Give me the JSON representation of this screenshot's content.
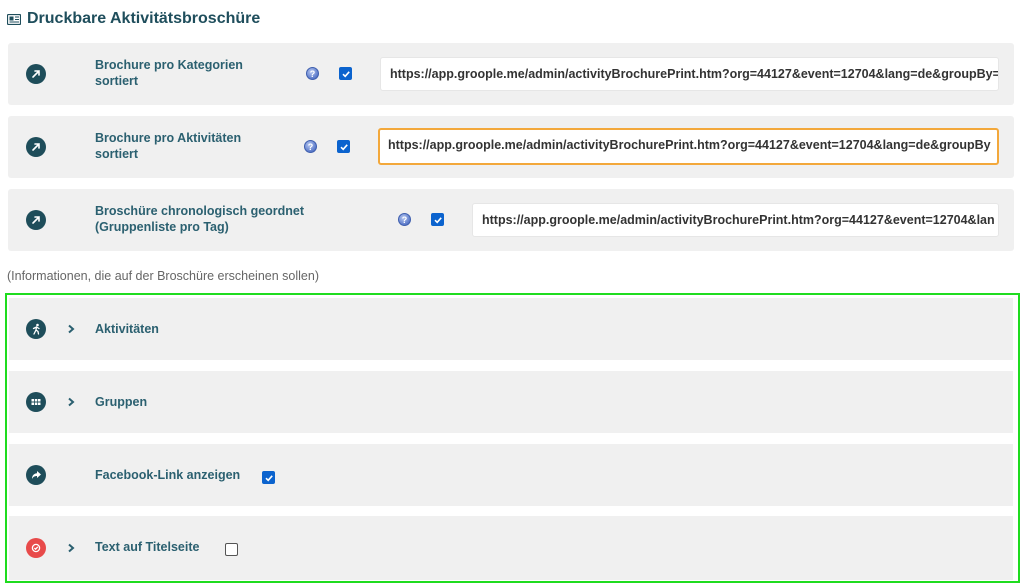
{
  "header": {
    "title": "Druckbare Aktivitätsbroschüre"
  },
  "brochures": [
    {
      "label_line1": "Brochure pro Kategorien",
      "label_line2": "sortiert",
      "url": "https://app.groople.me/admin/activityBrochurePrint.htm?org=44127&event=12704&lang=de&groupBy=",
      "checked": true
    },
    {
      "label_line1": "Brochure pro Aktivitäten",
      "label_line2": "sortiert",
      "url": "https://app.groople.me/admin/activityBrochurePrint.htm?org=44127&event=12704&lang=de&groupBy",
      "checked": true
    },
    {
      "label_line1": "Broschüre chronologisch geordnet",
      "label_line2": "(Gruppenliste pro Tag)",
      "url": "https://app.groople.me/admin/activityBrochurePrint.htm?org=44127&event=12704&lan",
      "checked": true
    }
  ],
  "help_glyph": "?",
  "note": "(Informationen, die auf der Broschüre erscheinen sollen)",
  "sections": [
    {
      "label": "Aktivitäten",
      "icon": "runner-icon"
    },
    {
      "label": "Gruppen",
      "icon": "grid-icon"
    },
    {
      "label": "Facebook-Link anzeigen",
      "icon": "share-arrow-icon",
      "checked": true
    },
    {
      "label": "Text auf Titelseite",
      "icon": "badge-check-icon",
      "checked": false
    }
  ],
  "colors": {
    "accent": "#1e4d5a",
    "checkbox": "#0b63ce",
    "focus": "#f3a83b",
    "highlight": "#1fdc1f",
    "alert": "#e84a4a"
  }
}
